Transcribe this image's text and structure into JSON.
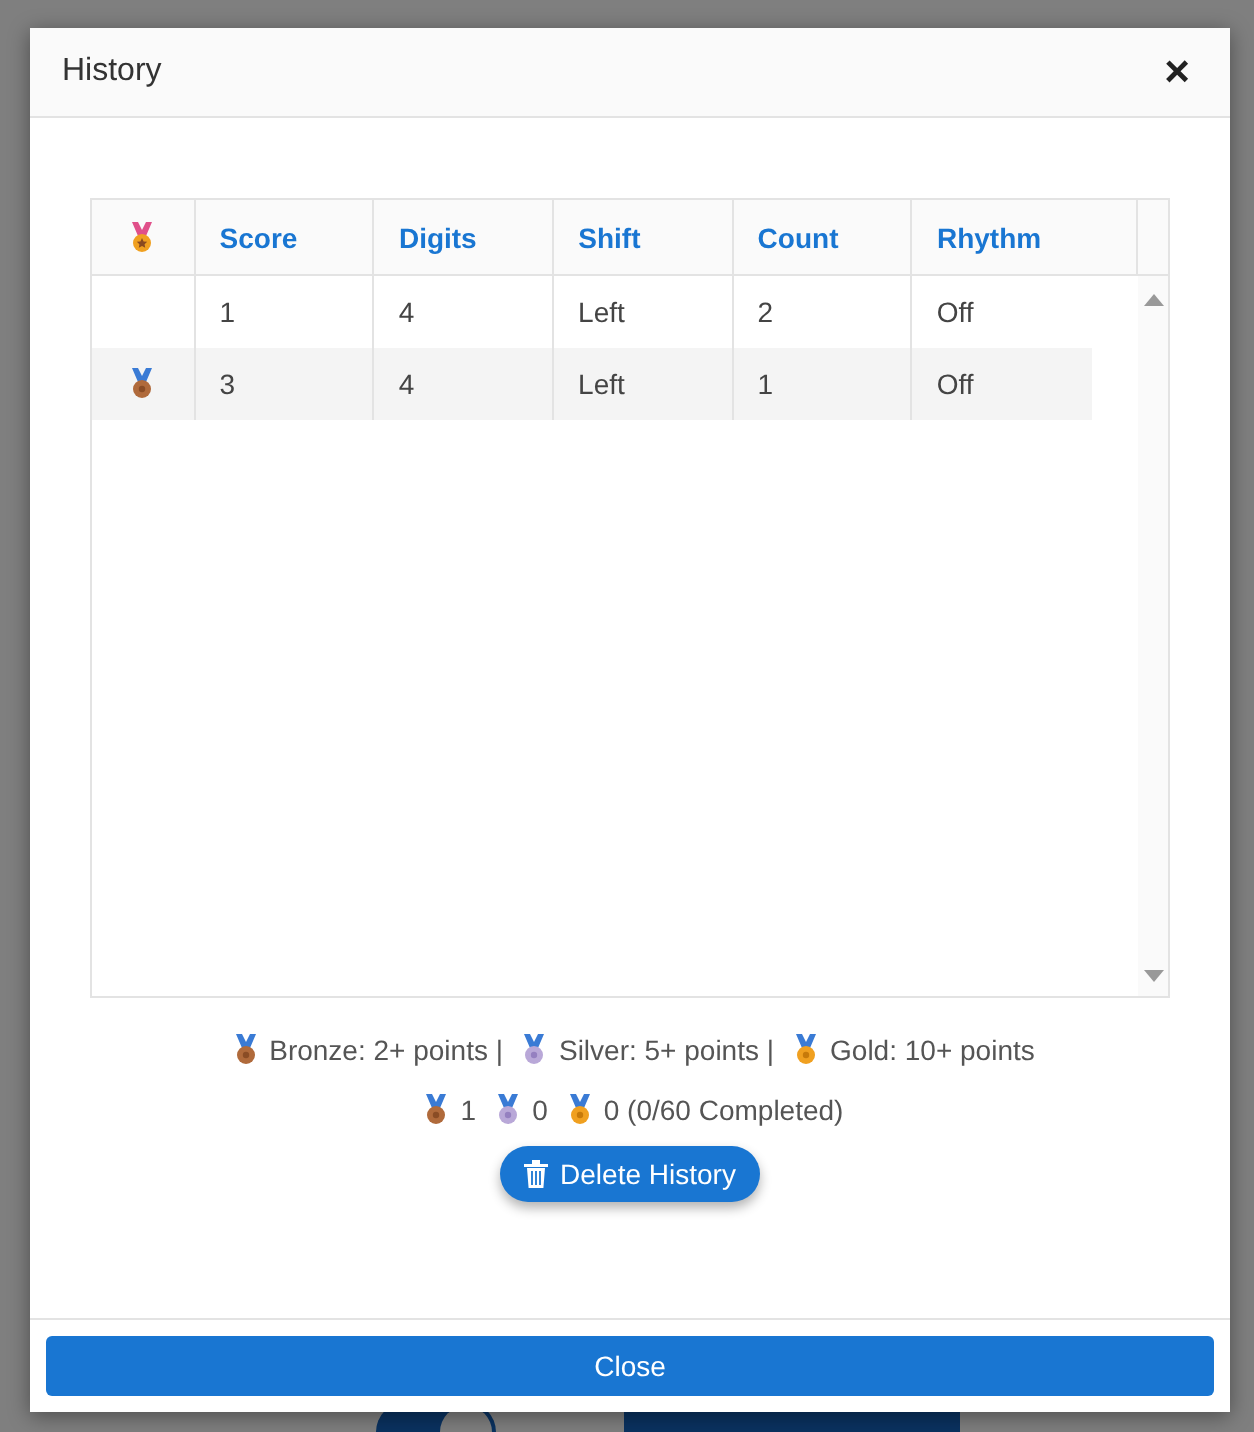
{
  "background": {
    "toggle": {
      "on": true
    }
  },
  "dialog": {
    "title": "History",
    "close_symbol": "×"
  },
  "table": {
    "columns": [
      "Score",
      "Digits",
      "Shift",
      "Count",
      "Rhythm"
    ],
    "rows": [
      {
        "cells": [
          "1",
          "4",
          "Left",
          "2",
          "Off"
        ]
      },
      {
        "medal": {
          "kind": "bronze"
        },
        "cells": [
          "3",
          "4",
          "Left",
          "1",
          "Off"
        ]
      }
    ]
  },
  "legend": [
    {
      "kind": "bronze",
      "text": "Bronze: 2+ points |"
    },
    {
      "kind": "silver",
      "text": "Silver: 5+ points |"
    },
    {
      "kind": "gold",
      "text": "Gold: 10+ points"
    }
  ],
  "counts": [
    {
      "kind": "bronze",
      "text": "1"
    },
    {
      "kind": "silver",
      "text": "0"
    },
    {
      "kind": "gold",
      "text": "0 (0/60 Completed)"
    }
  ],
  "delete_button": "Delete History",
  "close_button": "Close"
}
